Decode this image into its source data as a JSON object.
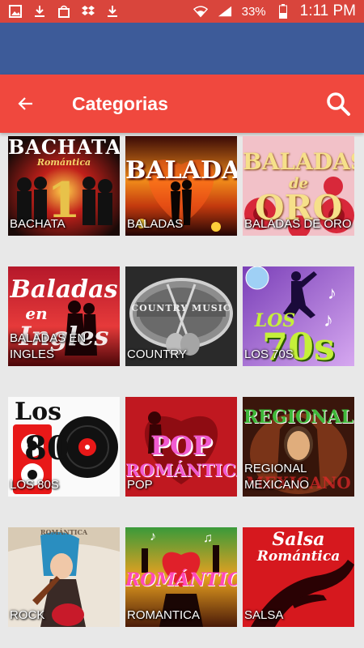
{
  "status_bar": {
    "battery": "33%",
    "time": "1:11 PM"
  },
  "toolbar": {
    "title": "Categorias"
  },
  "categories": [
    {
      "label": "BACHATA",
      "art_text": "BACHATA",
      "art_sub": "Romántica"
    },
    {
      "label": "BALADAS",
      "art_text": "BALADAS"
    },
    {
      "label": "BALADAS DE ORO",
      "art_text": "BALADAS",
      "art_sub": "de",
      "art_text2": "ORO"
    },
    {
      "label": "BALADAS EN INGLES",
      "art_text": "Baladas",
      "art_sub": "en",
      "art_text2": "Ingles"
    },
    {
      "label": "COUNTRY",
      "art_text": "COUNTRY MUSIC"
    },
    {
      "label": "LOS 70S",
      "art_text": "LOS",
      "art_text2": "70s"
    },
    {
      "label": "LOS 80S",
      "art_text": "Los",
      "art_text2": "80"
    },
    {
      "label": "POP",
      "art_text": "POP",
      "art_text2": "ROMÁNTICA"
    },
    {
      "label": "REGIONAL MEXICANO",
      "art_text": "REGIONAL",
      "art_text2": "MEXICANO"
    },
    {
      "label": "ROCK",
      "art_text": "ROMÁNTICA"
    },
    {
      "label": "ROMANTICA",
      "art_text": "ROMÁNTICA"
    },
    {
      "label": "SALSA",
      "art_text": "Salsa",
      "art_sub": "Romántica"
    }
  ],
  "icons": {
    "back": "arrow-left-icon",
    "search": "search-icon"
  },
  "colors": {
    "status_bar": "#d9453c",
    "blue_strip": "#3d5b99",
    "toolbar": "#f0483e",
    "background": "#e8e8e8"
  }
}
